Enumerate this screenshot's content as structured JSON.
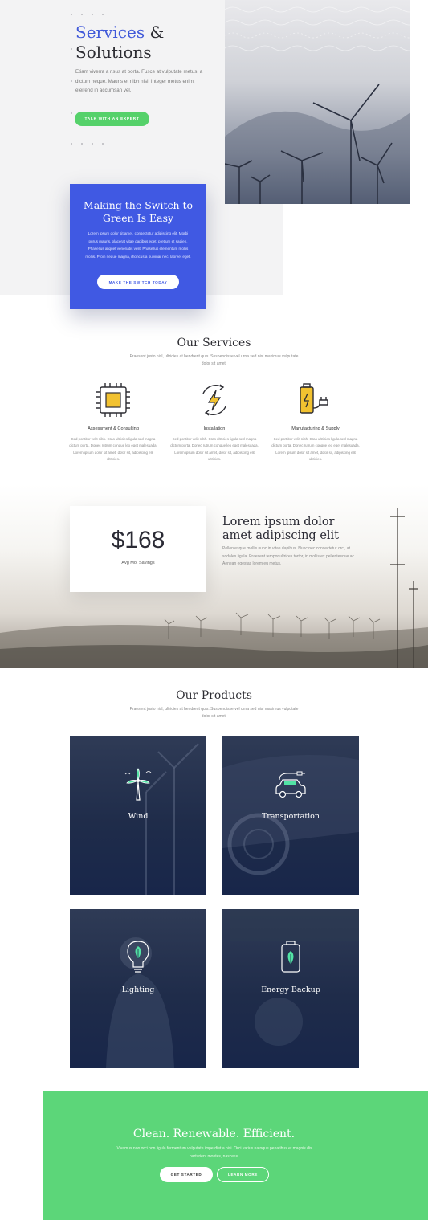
{
  "hero": {
    "title_accent": "Services",
    "title_amp": " &",
    "title_line2": "Solutions",
    "body": "Etiam viverra a risus at porta. Fusce at vulputate metus, a dictum neque. Mauris et nibh nisi. Integer metus enim, eleifend in accumsan vel.",
    "cta_label": "TALK WITH AN EXPERT"
  },
  "switch_card": {
    "title": "Making the Switch to Green Is Easy",
    "body": "Lorem ipsum dolor sit amet, consectetur adipiscing elit. Morbi purus mauris, placerat vitae dapibus eget, pretium et sapien. Phasellus aliquet venenatis velit. Phasellus elementum mollis mollis. Proin neque magna, rhoncus a pulvinar nec, laoreet eget.",
    "cta_label": "MAKE THE SWITCH TODAY"
  },
  "services": {
    "title": "Our Services",
    "subtitle": "Praesent justo nisl, ultricies at hendrerit quis. Suspendisse vel urna sed nisl maximus vulputate dolor sit amet.",
    "items": [
      {
        "name": "Assessment & Consulting",
        "icon": "chip-icon",
        "desc": "Sed porttitor velit nibh. Cras ultricies ligula sed magna dictum porta. Donec rutrum congue leo eget malesuada. Lorem ipsum dolor sit amet, dolor sit, adipiscing elit ultricies."
      },
      {
        "name": "Installation",
        "icon": "energy-cycle-icon",
        "desc": "Sed porttitor velit nibh. Cras ultricies ligula sed magna dictum porta. Donec rutrum congue leo eget malesuada. Lorem ipsum dolor sit amet, dolor sit, adipiscing elit ultricies."
      },
      {
        "name": "Manufacturing & Supply",
        "icon": "battery-plug-icon",
        "desc": "Sed porttitor velit nibh. Cras ultricies ligula sed magna dictum porta. Donec rutrum congue leo eget malesuada. Lorem ipsum dolor sit amet, dolor sit, adipiscing elit ultricies."
      }
    ]
  },
  "savings": {
    "value": "$168",
    "label": "Avg Mo. Savings",
    "title": "Lorem ipsum dolor amet adipiscing elit",
    "body": "Pellentesque mollis nunc in vitae dapibus. Nunc nec consectetur orci, at sodales ligula. Praesent tempor ultrices tortor, in mollis ex pellentesque ac. Aenean egestas lorem eu metus."
  },
  "products": {
    "title": "Our Products",
    "subtitle": "Praesent justo nisl, ultricies at hendrerit quis. Suspendisse vel urna sed nisl maximus vulputate dolor sit amet.",
    "items": [
      {
        "name": "Wind",
        "icon": "wind-turbine-icon"
      },
      {
        "name": "Transportation",
        "icon": "electric-car-icon"
      },
      {
        "name": "Lighting",
        "icon": "leaf-bulb-icon"
      },
      {
        "name": "Energy Backup",
        "icon": "leaf-battery-icon"
      }
    ]
  },
  "cta": {
    "title": "Clean. Renewable. Efficient.",
    "body": "Vivamus non orci non ligula fermentum vulputate imperdiet a nisi. Orci varius natoque penatibus et magnis dis parturient montes, nascetur.",
    "primary_label": "GET STARTED",
    "secondary_label": "LEARN MORE"
  },
  "colors": {
    "accent_blue": "#4059e3",
    "accent_green": "#5cd679",
    "icon_yellow": "#f2c230",
    "product_icon_green": "#52e3a5"
  }
}
